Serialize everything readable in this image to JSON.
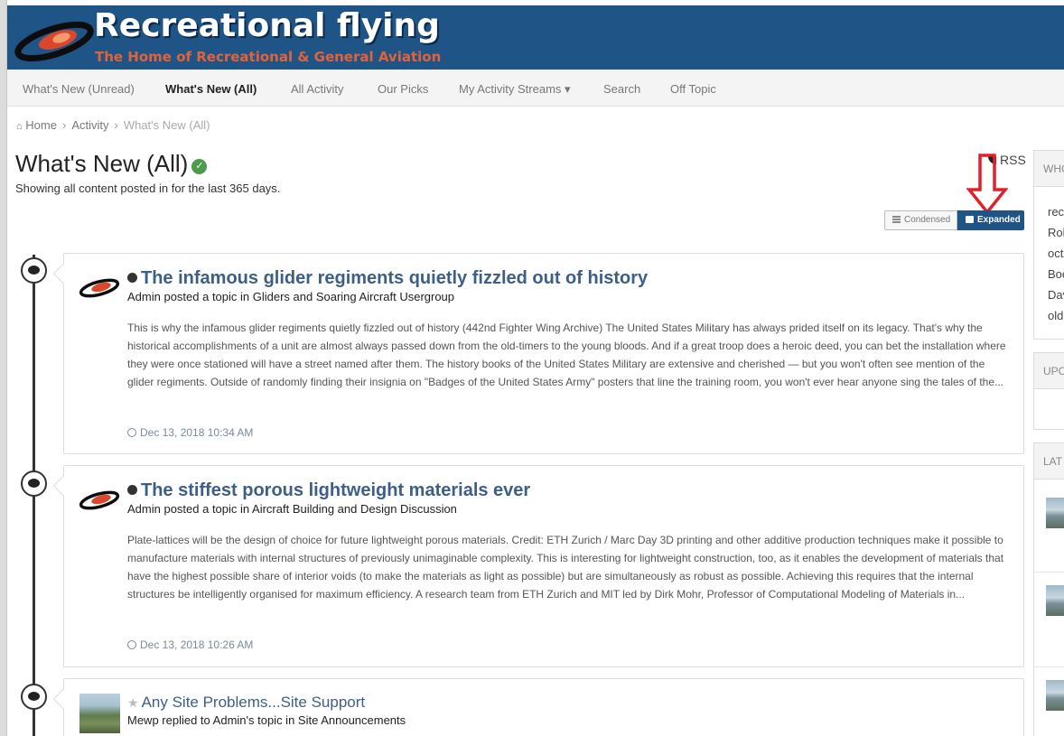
{
  "site": {
    "title": "Recreational flying",
    "subtitle": "The Home of Recreational & General Aviation"
  },
  "nav": {
    "items": [
      {
        "label": "What's New (Unread)"
      },
      {
        "label": "What's New (All)"
      },
      {
        "label": "All Activity"
      },
      {
        "label": "Our Picks"
      },
      {
        "label": "My Activity Streams ▾"
      },
      {
        "label": "Search"
      },
      {
        "label": "Off Topic"
      }
    ]
  },
  "breadcrumb": {
    "home": "Home",
    "activity": "Activity",
    "current": "What's New (All)"
  },
  "page": {
    "title": "What's New (All)",
    "subtitle": "Showing all content posted in for the last 365 days.",
    "rss": "RSS"
  },
  "view_toggle": {
    "condensed": "Condensed",
    "expanded": "Expanded"
  },
  "feed": [
    {
      "title": "The infamous glider regiments quietly fizzled out of history",
      "meta": "Admin posted a topic in Gliders and Soaring Aircraft Usergroup",
      "body": "This is why the infamous glider regiments quietly fizzled out of history (442nd Fighter Wing Archive) The United States Military has always prided itself on its legacy. That's why the historical accomplishments of a unit are almost always passed down from the old-timers to the young bloods. And if a great troop does a heroic deed, you can bet the installation where they were once stationed will have a street named after them. The history books of the United States Military are extensive and cherished — but you won't often see mention of the glider regiments. Outside of randomly finding their insignia on \"Badges of the United States Army\" posters that line the training room, you won't ever hear anyone sing the tales of the...",
      "date": "Dec 13, 2018 10:34 AM"
    },
    {
      "title": "The stiffest porous lightweight materials ever",
      "meta": "Admin posted a topic in Aircraft Building and Design Discussion",
      "body": "Plate-lattices will be the design of choice for future lightweight porous materials. Credit: ETH Zurich / Marc Day 3D printing and other additive production techniques make it possible to manufacture materials with internal structures of previously unimaginable complexity. This is interesting for lightweight construction, too, as it enables the development of materials that have the highest possible share of interior voids (to make the materials as light as possible) but are simultaneously as robust as possible. Achieving this requires that the internal structures be intelligently organised for maximum efficiency. A research team from ETH Zurich and MIT led by Dirk Mohr, Professor of Computational Modeling of Materials in...",
      "date": "Dec 13, 2018 10:26 AM"
    },
    {
      "title": "Any Site Problems...Site Support",
      "meta": "Mewp replied to Admin's topic in Site Announcements"
    }
  ],
  "sidebar": {
    "panel1_head": "WHO",
    "panel1_lines": [
      "rec",
      "Rol",
      "oct",
      "Boo",
      "Dav",
      "old"
    ],
    "panel2_head": "UPC",
    "panel3_head": "LAT"
  },
  "colors": {
    "brand": "#1f5486",
    "accent_orange": "#e2623a",
    "link": "#3d5f86",
    "verified": "#4b9c4b",
    "annotation_arrow": "#e0202a"
  }
}
